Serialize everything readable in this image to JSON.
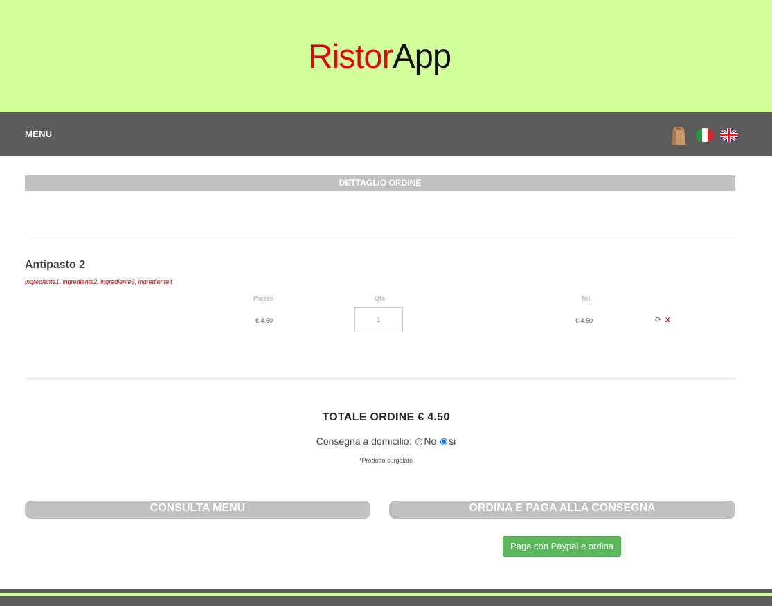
{
  "brand": {
    "logo_part1": "Ristor",
    "logo_part2": "App"
  },
  "nav": {
    "menu_label": "MENU",
    "icons": [
      "shopping-bag-icon",
      "flag-italy-icon",
      "flag-uk-icon"
    ]
  },
  "order": {
    "section_title": "DETTAGLIO ORDINE",
    "item": {
      "name": "Antipasto 2",
      "ingredients": "ingrediente1, ingrediente2, ingrediente3, ingrediente4",
      "price_header": "Prezzo",
      "qty_header": "Qtà",
      "total_header": "Tot.",
      "price": "€ 4.50",
      "qty": "1",
      "total": "€ 4.50",
      "refresh_symbol": "⟳",
      "remove_symbol": "x"
    },
    "total_label": "TOTALE ORDINE € 4.50",
    "delivery_label": "Consegna a domicilio:",
    "delivery_options": [
      {
        "label": "No",
        "selected": false
      },
      {
        "label": "si",
        "selected": true
      }
    ],
    "note": "*Prodotto surgelato"
  },
  "actions": {
    "consult_menu": "CONSULTA MENU",
    "order_pay_delivery": "ORDINA E PAGA ALLA CONSEGNA",
    "paypal": "Paga con Paypal e ordina"
  },
  "colors": {
    "header_bg": "#d1ff9c",
    "nav_bg": "#5b5b5b",
    "accent_red": "#e30613",
    "paypal_green": "#5cb85c"
  }
}
